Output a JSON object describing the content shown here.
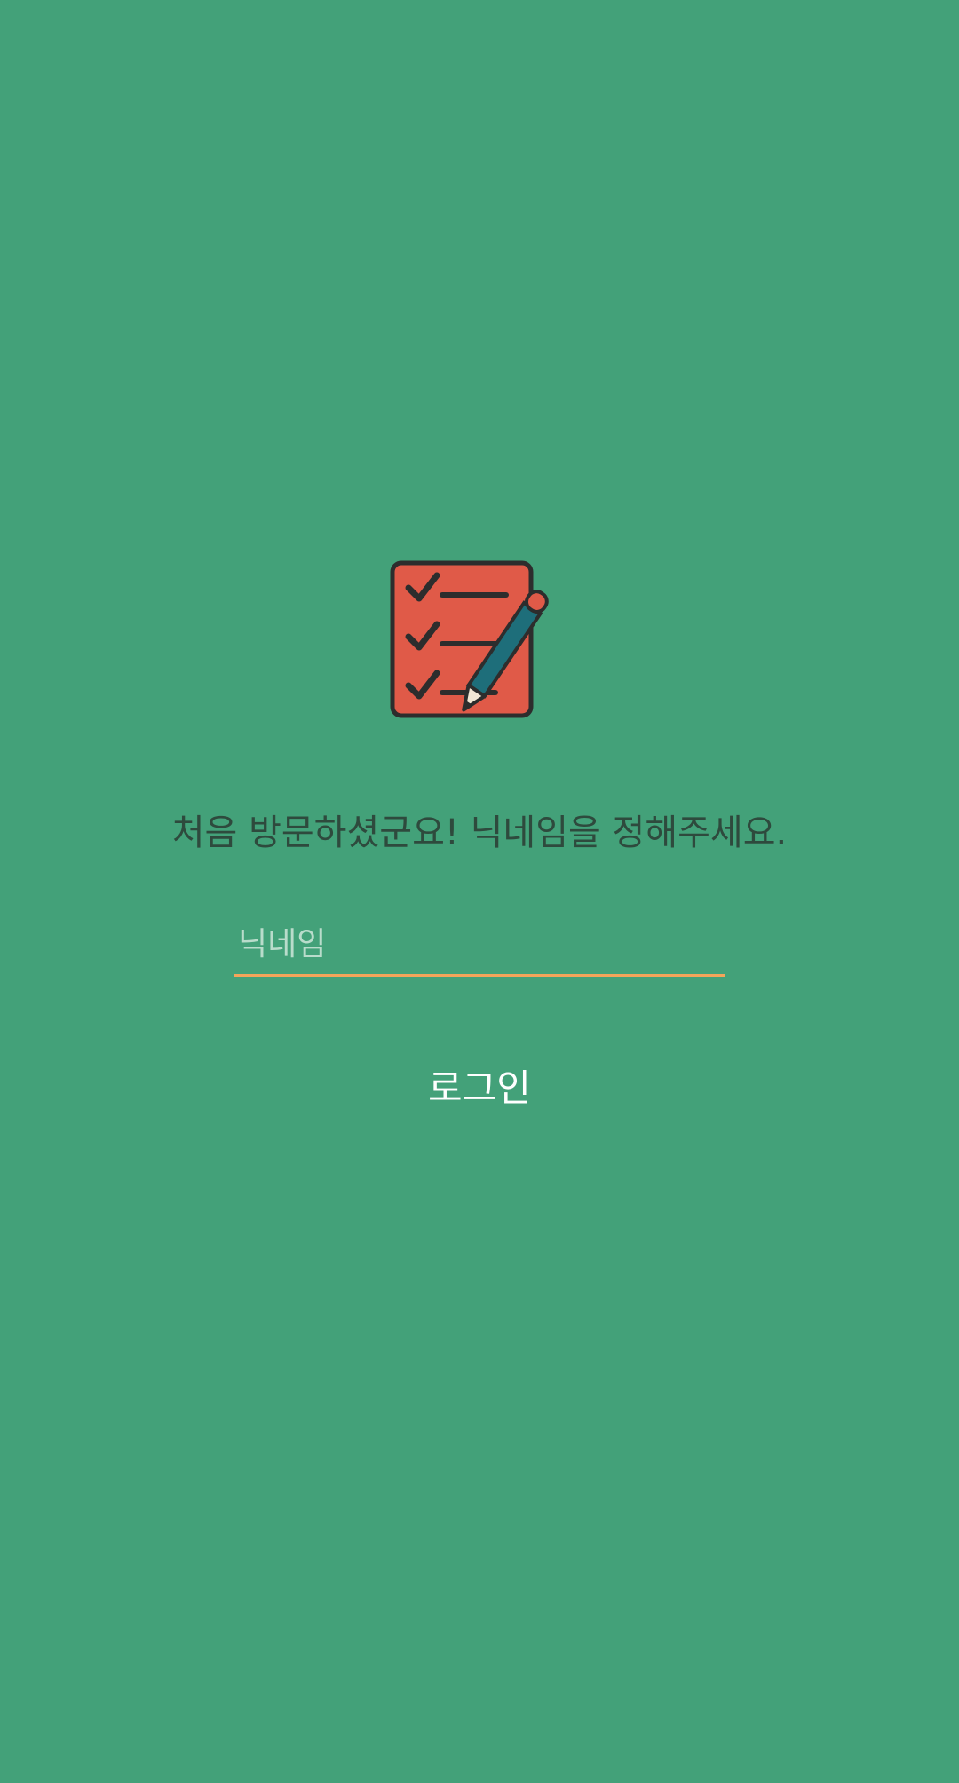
{
  "icons": {
    "logo": "checklist-with-pencil-icon"
  },
  "colors": {
    "background": "#43A179",
    "accent_underline": "#F4A55A",
    "clipboard": "#E05A48",
    "pencil": "#1E6E7A"
  },
  "welcome": {
    "message": "처음 방문하셨군요! 닉네임을 정해주세요."
  },
  "nickname": {
    "placeholder": "닉네임",
    "value": ""
  },
  "login": {
    "label": "로그인"
  }
}
